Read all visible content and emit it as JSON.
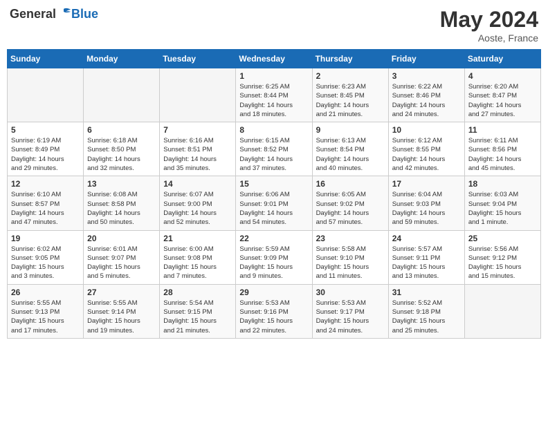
{
  "header": {
    "logo_general": "General",
    "logo_blue": "Blue",
    "month_title": "May 2024",
    "location": "Aoste, France"
  },
  "days_of_week": [
    "Sunday",
    "Monday",
    "Tuesday",
    "Wednesday",
    "Thursday",
    "Friday",
    "Saturday"
  ],
  "weeks": [
    [
      {
        "day": "",
        "info": ""
      },
      {
        "day": "",
        "info": ""
      },
      {
        "day": "",
        "info": ""
      },
      {
        "day": "1",
        "info": "Sunrise: 6:25 AM\nSunset: 8:44 PM\nDaylight: 14 hours\nand 18 minutes."
      },
      {
        "day": "2",
        "info": "Sunrise: 6:23 AM\nSunset: 8:45 PM\nDaylight: 14 hours\nand 21 minutes."
      },
      {
        "day": "3",
        "info": "Sunrise: 6:22 AM\nSunset: 8:46 PM\nDaylight: 14 hours\nand 24 minutes."
      },
      {
        "day": "4",
        "info": "Sunrise: 6:20 AM\nSunset: 8:47 PM\nDaylight: 14 hours\nand 27 minutes."
      }
    ],
    [
      {
        "day": "5",
        "info": "Sunrise: 6:19 AM\nSunset: 8:49 PM\nDaylight: 14 hours\nand 29 minutes."
      },
      {
        "day": "6",
        "info": "Sunrise: 6:18 AM\nSunset: 8:50 PM\nDaylight: 14 hours\nand 32 minutes."
      },
      {
        "day": "7",
        "info": "Sunrise: 6:16 AM\nSunset: 8:51 PM\nDaylight: 14 hours\nand 35 minutes."
      },
      {
        "day": "8",
        "info": "Sunrise: 6:15 AM\nSunset: 8:52 PM\nDaylight: 14 hours\nand 37 minutes."
      },
      {
        "day": "9",
        "info": "Sunrise: 6:13 AM\nSunset: 8:54 PM\nDaylight: 14 hours\nand 40 minutes."
      },
      {
        "day": "10",
        "info": "Sunrise: 6:12 AM\nSunset: 8:55 PM\nDaylight: 14 hours\nand 42 minutes."
      },
      {
        "day": "11",
        "info": "Sunrise: 6:11 AM\nSunset: 8:56 PM\nDaylight: 14 hours\nand 45 minutes."
      }
    ],
    [
      {
        "day": "12",
        "info": "Sunrise: 6:10 AM\nSunset: 8:57 PM\nDaylight: 14 hours\nand 47 minutes."
      },
      {
        "day": "13",
        "info": "Sunrise: 6:08 AM\nSunset: 8:58 PM\nDaylight: 14 hours\nand 50 minutes."
      },
      {
        "day": "14",
        "info": "Sunrise: 6:07 AM\nSunset: 9:00 PM\nDaylight: 14 hours\nand 52 minutes."
      },
      {
        "day": "15",
        "info": "Sunrise: 6:06 AM\nSunset: 9:01 PM\nDaylight: 14 hours\nand 54 minutes."
      },
      {
        "day": "16",
        "info": "Sunrise: 6:05 AM\nSunset: 9:02 PM\nDaylight: 14 hours\nand 57 minutes."
      },
      {
        "day": "17",
        "info": "Sunrise: 6:04 AM\nSunset: 9:03 PM\nDaylight: 14 hours\nand 59 minutes."
      },
      {
        "day": "18",
        "info": "Sunrise: 6:03 AM\nSunset: 9:04 PM\nDaylight: 15 hours\nand 1 minute."
      }
    ],
    [
      {
        "day": "19",
        "info": "Sunrise: 6:02 AM\nSunset: 9:05 PM\nDaylight: 15 hours\nand 3 minutes."
      },
      {
        "day": "20",
        "info": "Sunrise: 6:01 AM\nSunset: 9:07 PM\nDaylight: 15 hours\nand 5 minutes."
      },
      {
        "day": "21",
        "info": "Sunrise: 6:00 AM\nSunset: 9:08 PM\nDaylight: 15 hours\nand 7 minutes."
      },
      {
        "day": "22",
        "info": "Sunrise: 5:59 AM\nSunset: 9:09 PM\nDaylight: 15 hours\nand 9 minutes."
      },
      {
        "day": "23",
        "info": "Sunrise: 5:58 AM\nSunset: 9:10 PM\nDaylight: 15 hours\nand 11 minutes."
      },
      {
        "day": "24",
        "info": "Sunrise: 5:57 AM\nSunset: 9:11 PM\nDaylight: 15 hours\nand 13 minutes."
      },
      {
        "day": "25",
        "info": "Sunrise: 5:56 AM\nSunset: 9:12 PM\nDaylight: 15 hours\nand 15 minutes."
      }
    ],
    [
      {
        "day": "26",
        "info": "Sunrise: 5:55 AM\nSunset: 9:13 PM\nDaylight: 15 hours\nand 17 minutes."
      },
      {
        "day": "27",
        "info": "Sunrise: 5:55 AM\nSunset: 9:14 PM\nDaylight: 15 hours\nand 19 minutes."
      },
      {
        "day": "28",
        "info": "Sunrise: 5:54 AM\nSunset: 9:15 PM\nDaylight: 15 hours\nand 21 minutes."
      },
      {
        "day": "29",
        "info": "Sunrise: 5:53 AM\nSunset: 9:16 PM\nDaylight: 15 hours\nand 22 minutes."
      },
      {
        "day": "30",
        "info": "Sunrise: 5:53 AM\nSunset: 9:17 PM\nDaylight: 15 hours\nand 24 minutes."
      },
      {
        "day": "31",
        "info": "Sunrise: 5:52 AM\nSunset: 9:18 PM\nDaylight: 15 hours\nand 25 minutes."
      },
      {
        "day": "",
        "info": ""
      }
    ]
  ]
}
